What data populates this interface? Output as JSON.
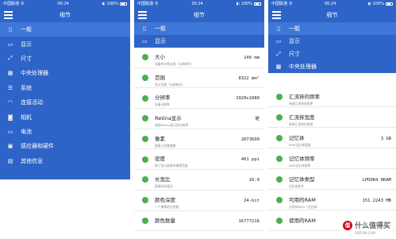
{
  "status_bar": {
    "carrier": "中国联通 令",
    "time": "00:24",
    "battery": "◐ 100%"
  },
  "header": {
    "title": "细节"
  },
  "icons": {
    "menu": "hamburger-icon",
    "row_marker": "green-dot"
  },
  "colors": {
    "primary": "#2e64c7",
    "selected": "#3f77d9",
    "dot": "#4caf50"
  },
  "menu": {
    "items": [
      {
        "label": "一般",
        "icon": "phone-icon",
        "glyph": "▯"
      },
      {
        "label": "显示",
        "icon": "monitor-icon",
        "glyph": "▭"
      },
      {
        "label": "尺寸",
        "icon": "resize-icon",
        "glyph": "⤢"
      },
      {
        "label": "中央处理器",
        "icon": "cpu-icon",
        "glyph": "▦"
      },
      {
        "label": "系统",
        "icon": "system-icon",
        "glyph": "☰"
      },
      {
        "label": "连接活动",
        "icon": "wifi-icon",
        "glyph": "◠"
      },
      {
        "label": "相机",
        "icon": "camera-icon",
        "glyph": "◙"
      },
      {
        "label": "电池",
        "icon": "battery-icon",
        "glyph": "▭"
      },
      {
        "label": "感应器和硬件",
        "icon": "sensor-icon",
        "glyph": "▣"
      },
      {
        "label": "其他信息",
        "icon": "info-icon",
        "glyph": "▤"
      }
    ],
    "selected_index": 0
  },
  "display_details": [
    {
      "label": "大小",
      "value": "140 mm",
      "sub": "设备的对角长度（公制单位）"
    },
    {
      "label": "范围",
      "value": "8322 mm²",
      "sub": "显示范围（公制单位）"
    },
    {
      "label": "分辨率",
      "value": "1920x1080",
      "sub": "设备分辨率"
    },
    {
      "label": "Retina显示",
      "value": "是",
      "sub": "其配Retina显示屏分辨率"
    },
    {
      "label": "像素",
      "value": "2073600",
      "sub": "屏幕上的像素数"
    },
    {
      "label": "密度",
      "value": "401 ppi",
      "sub": "每寸显示屏幕的像素密度"
    },
    {
      "label": "长宽比",
      "value": "16:9",
      "sub": "屏幕的长宽比"
    },
    {
      "label": "颜色深度",
      "value": "24-bit",
      "sub": "一个像素的比特数"
    },
    {
      "label": "颜色数量",
      "value": "16777216",
      "sub": ""
    }
  ],
  "cpu_details": [
    {
      "label": "汇流排的频率",
      "value": "",
      "sub": "系统汇流排的频率"
    },
    {
      "label": "汇流排宽度",
      "value": "",
      "sub": "系统汇流排的宽度"
    },
    {
      "label": "记忆体",
      "value": "3 GB",
      "sub": "RAM记忆体容量"
    },
    {
      "label": "记忆体频率",
      "value": "",
      "sub": "RAM记忆体频率"
    },
    {
      "label": "记忆体类型",
      "value": "LPDDR4 DRAM",
      "sub": "记忆体技术"
    },
    {
      "label": "可用的RAM",
      "value": "151.2243 MB",
      "sub": "可用的RAM（记忆体）"
    },
    {
      "label": "使用的RAM",
      "value": "",
      "sub": ""
    }
  ],
  "watermark": {
    "logo": "值",
    "text": "什么值得买",
    "url": "SMZDM.COM"
  }
}
